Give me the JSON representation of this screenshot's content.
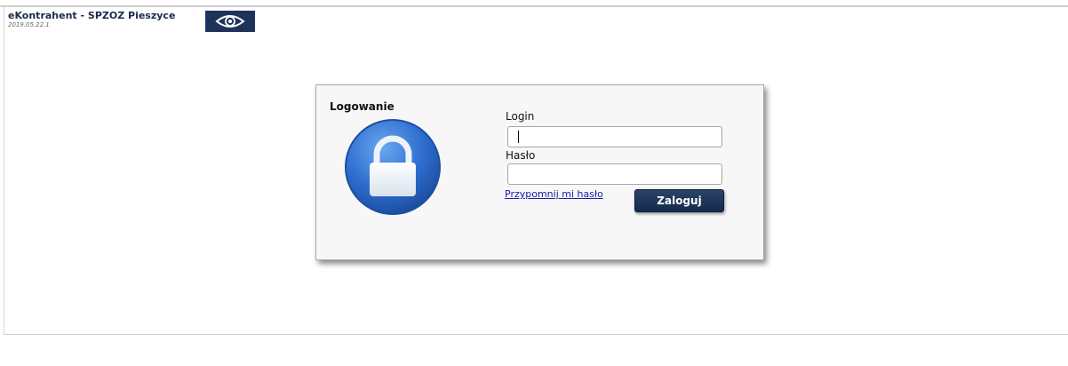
{
  "header": {
    "app_title": "eKontrahent - SPZOZ Pieszyce",
    "version": "2019.05.22.1",
    "logo_icon": "eye-icon"
  },
  "login": {
    "title": "Logowanie",
    "icon": "lock-icon",
    "login_label": "Login",
    "login_value": "",
    "password_label": "Hasło",
    "password_value": "",
    "remind_link": "Przypomnij mi hasło",
    "submit_label": "Zaloguj"
  },
  "colors": {
    "brand_navy": "#1e3359",
    "button_navy": "#1f3558",
    "lock_blue": "#2e6fcf",
    "link_blue": "#1a1aa6"
  }
}
